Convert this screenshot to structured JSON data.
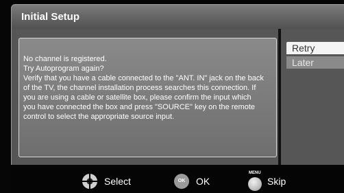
{
  "header": {
    "title": "Initial Setup"
  },
  "message": {
    "lines": [
      "No channel is registered.",
      "Try Autoprogram again?",
      "Verify that you have a cable connected to the \"ANT. IN\" jack on the  back",
      "of the TV, the channel installation process searches this connection. If",
      "you are using a cable or satellite box, please confirm the input which",
      "you have connected the box and press \"SOURCE\" key on the remote",
      "control to select the appropriate source input."
    ]
  },
  "options": {
    "retry_label": "Retry",
    "later_label": "Later",
    "selected": "Retry"
  },
  "footer": {
    "select_label": "Select",
    "ok_icon_text": "OK",
    "ok_label": "OK",
    "menu_icon_text": "MENU",
    "skip_label": "Skip",
    "icons": [
      "dpad-icon",
      "ok-button-icon",
      "menu-button-icon"
    ]
  }
}
